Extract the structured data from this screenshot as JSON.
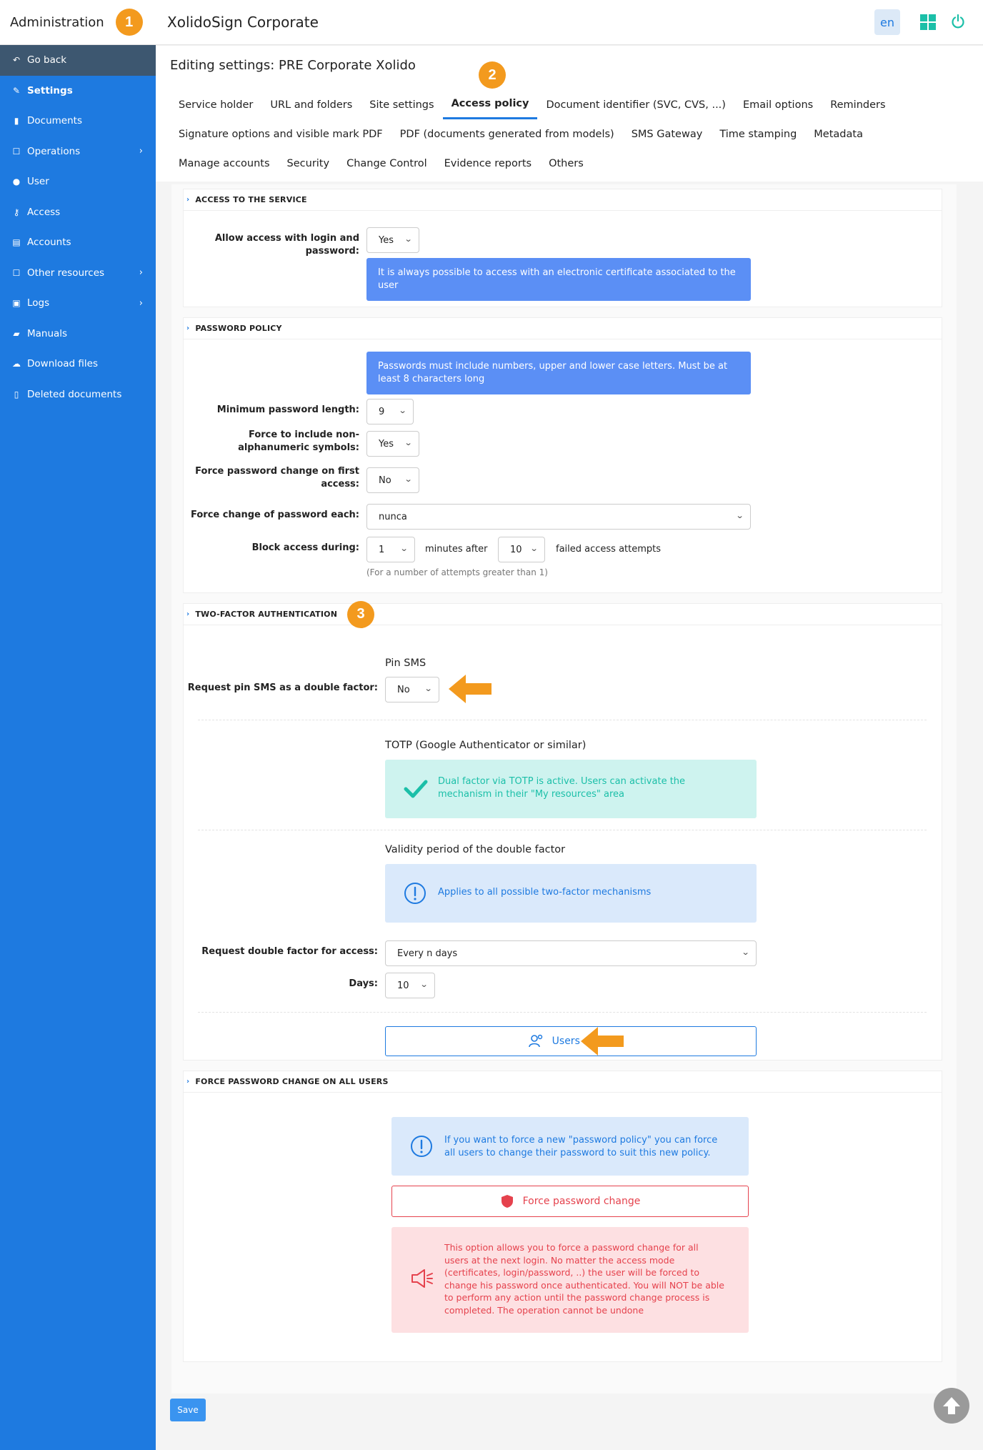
{
  "sidebar": {
    "title": "Administration",
    "badge": "1",
    "items": [
      {
        "label": "Go back",
        "icon": "undo-icon"
      },
      {
        "label": "Settings",
        "icon": "wrench-icon"
      },
      {
        "label": "Documents",
        "icon": "file-icon"
      },
      {
        "label": "Operations",
        "icon": "edit-icon"
      },
      {
        "label": "User",
        "icon": "user-icon"
      },
      {
        "label": "Access",
        "icon": "key-icon"
      },
      {
        "label": "Accounts",
        "icon": "id-card-icon"
      },
      {
        "label": "Other resources",
        "icon": "edit-icon"
      },
      {
        "label": "Logs",
        "icon": "log-icon"
      },
      {
        "label": "Manuals",
        "icon": "book-icon"
      },
      {
        "label": "Download files",
        "icon": "cloud-download-icon"
      },
      {
        "label": "Deleted documents",
        "icon": "trash-icon"
      }
    ]
  },
  "header": {
    "corp": "XolidoSign Corporate",
    "lang": "en"
  },
  "page": {
    "title": "Editing settings: PRE Corporate Xolido",
    "badge2": "2",
    "badge3": "3"
  },
  "tabs": {
    "row1": [
      "Service holder",
      "URL and folders",
      "Site settings",
      "Access policy",
      "Document identifier (SVC, CVS, ...)",
      "Email options",
      "Reminders"
    ],
    "row2": [
      "Signature options and visible mark PDF",
      "PDF (documents generated from models)",
      "SMS Gateway",
      "Time stamping",
      "Metadata"
    ],
    "row3": [
      "Manage accounts",
      "Security",
      "Change Control",
      "Evidence reports",
      "Others"
    ]
  },
  "access": {
    "header": "ACCESS TO THE SERVICE",
    "login_label": "Allow access with login and password:",
    "login_value": "Yes",
    "info": "It is always possible to access with an electronic certificate associated to the user"
  },
  "password": {
    "header": "PASSWORD POLICY",
    "info": "Passwords must include numbers, upper and lower case letters. Must be at least 8 characters long",
    "min_len_label": "Minimum password length:",
    "min_len_value": "9",
    "nonalpha_label": "Force to include non-alphanumeric symbols:",
    "nonalpha_value": "Yes",
    "first_label": "Force password change on first access:",
    "first_value": "No",
    "each_label": "Force change of password each:",
    "each_value": "nunca",
    "block_label": "Block access during:",
    "block_value": "1",
    "minutes_after": "minutes after",
    "attempts_value": "10",
    "failed_attempts": "failed access attempts",
    "attempts_hint": "(For a number of attempts greater than 1)"
  },
  "twofa": {
    "header": "TWO-FACTOR AUTHENTICATION",
    "pin_sms_title": "Pin SMS",
    "pin_sms_label": "Request pin SMS as a double factor:",
    "pin_sms_value": "No",
    "totp_title": "TOTP (Google Authenticator or similar)",
    "totp_info": "Dual factor via TOTP is active. Users can activate the mechanism in their \"My resources\" area",
    "validity_title": "Validity period of the double factor",
    "validity_info": "Applies to all possible two-factor mechanisms",
    "request_label": "Request double factor for access:",
    "request_value": "Every n days",
    "days_label": "Days:",
    "days_value": "10",
    "users_status": "Users status"
  },
  "force": {
    "header": "FORCE PASSWORD CHANGE ON ALL USERS",
    "info": "If you want to force a new \"password policy\" you can force all users to change their password to suit this new policy.",
    "button": "Force password change",
    "warning": "This option allows you to force a password change for all users at the next login. No matter the access mode (certificates, login/password, ..) the user will be forced to change his password once authenticated. You will NOT be able to perform any action until the password change process is completed. The operation cannot be undone"
  },
  "footer": {
    "save": "Save"
  },
  "colors": {
    "sidebar": "#1e7ae0",
    "accent_badge": "#f39a1e",
    "info_blue": "#5b8ff5",
    "success": "#1bbfa8",
    "danger": "#e5424d"
  }
}
